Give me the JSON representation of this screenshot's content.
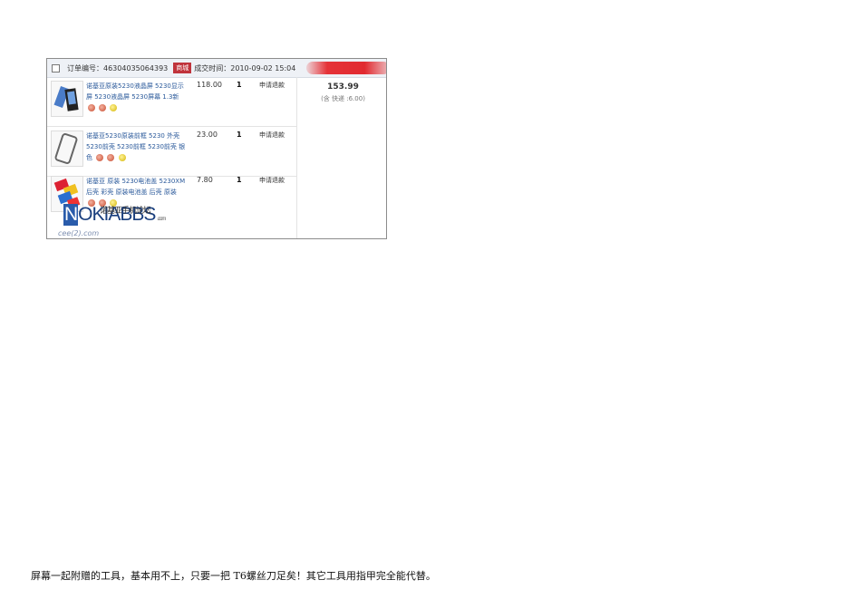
{
  "order": {
    "order_no_label": "订单编号：46304035064393",
    "mall_badge": "商城",
    "deal_time": "成交时间：2010-09-02 15:04",
    "total": "153.99",
    "shipping_note": "(含 快递 :6.00)",
    "items": [
      {
        "title": "诺基亚原装5230液晶屏 5230显示屏 5230液晶屏 5230屏幕 1.3新",
        "price": "118.00",
        "qty": "1",
        "action": "申请退款"
      },
      {
        "title": "诺基亚5230原装前框 5230 外壳 5230前壳 5230前框 5230前壳 银色",
        "price": "23.00",
        "qty": "1",
        "action": "申请退款"
      },
      {
        "title": "诺基亚 原装 5230电池盖 5230XM 后壳 彩壳 原装电池盖 后壳 原装",
        "price": "7.80",
        "qty": "1",
        "action": "申请退款"
      }
    ]
  },
  "watermark": {
    "brand_n": "N",
    "brand_rest": "OKIABBS",
    "brand_cn": "诺基亚手机论坛",
    "brand_com": ".com",
    "sub": "cee(2).com"
  },
  "caption": "屏幕一起附赠的工具，基本用不上，只要一把 T6螺丝刀足矣！其它工具用指甲完全能代替。"
}
